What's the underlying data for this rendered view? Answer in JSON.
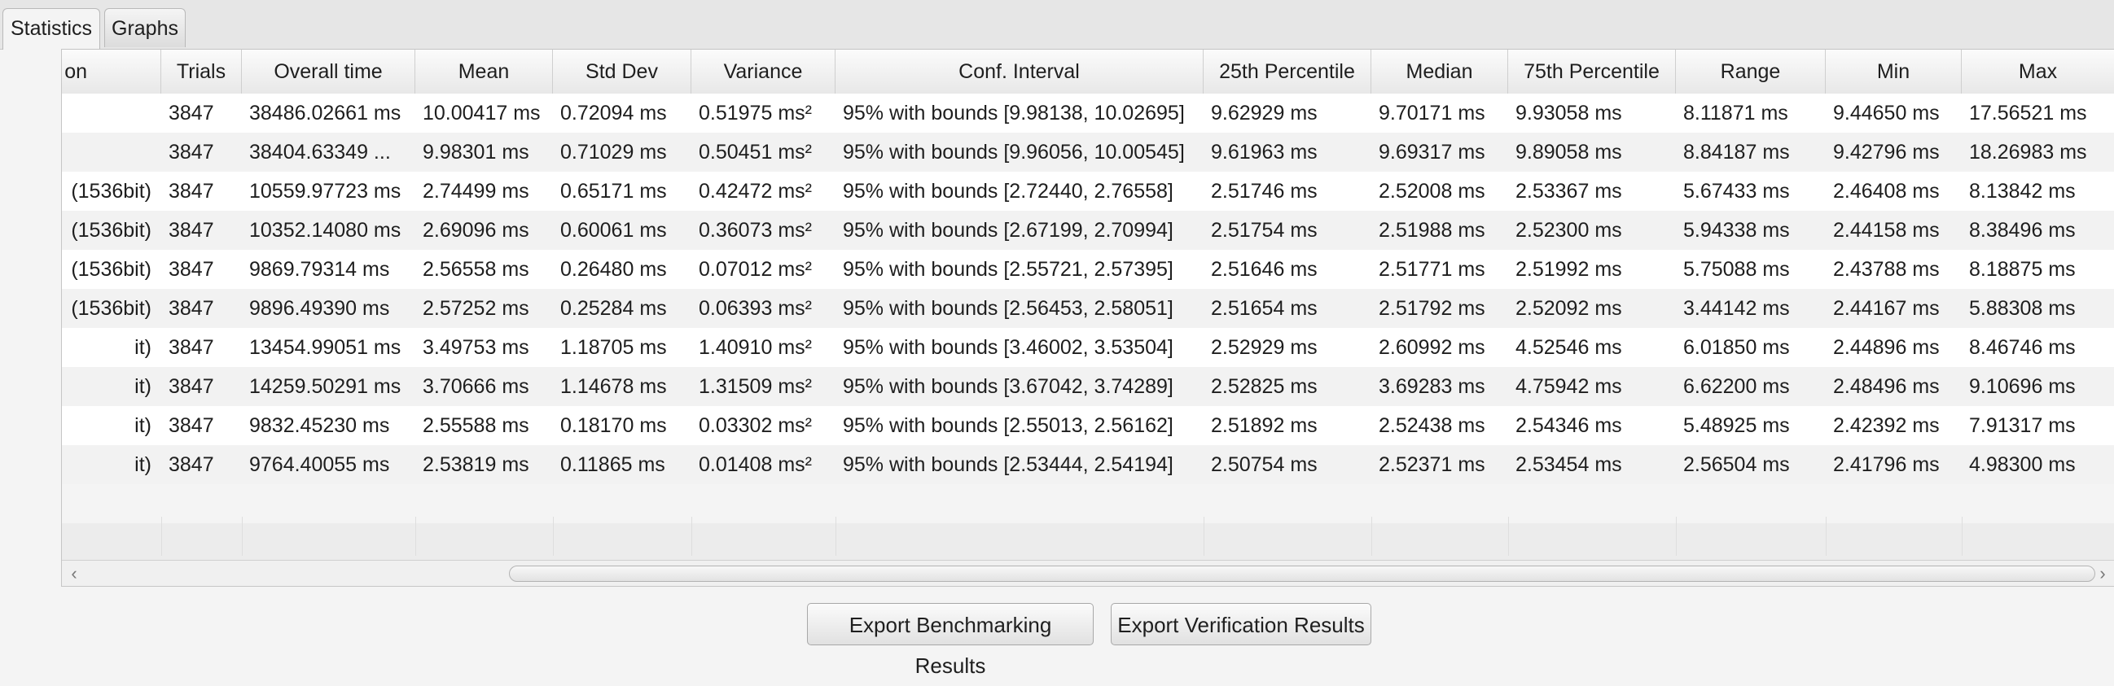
{
  "tabs": [
    {
      "label": "Statistics",
      "selected": true
    },
    {
      "label": "Graphs",
      "selected": false
    }
  ],
  "table": {
    "columns": [
      "on",
      "Trials",
      "Overall time",
      "Mean",
      "Std Dev",
      "Variance",
      "Conf. Interval",
      "25th Percentile",
      "Median",
      "75th Percentile",
      "Range",
      "Min",
      "Max"
    ],
    "rows": [
      [
        "",
        "3847",
        "38486.02661 ms",
        "10.00417 ms",
        "0.72094 ms",
        "0.51975 ms²",
        "95% with bounds [9.98138, 10.02695]",
        "9.62929 ms",
        "9.70171 ms",
        "9.93058 ms",
        "8.11871 ms",
        "9.44650 ms",
        "17.56521 ms"
      ],
      [
        "",
        "3847",
        "38404.63349 ...",
        "9.98301 ms",
        "0.71029 ms",
        "0.50451 ms²",
        "95% with bounds [9.96056, 10.00545]",
        "9.61963 ms",
        "9.69317 ms",
        "9.89058 ms",
        "8.84187 ms",
        "9.42796 ms",
        "18.26983 ms"
      ],
      [
        "(1536bit)",
        "3847",
        "10559.97723 ms",
        "2.74499 ms",
        "0.65171 ms",
        "0.42472 ms²",
        "95% with bounds [2.72440, 2.76558]",
        "2.51746 ms",
        "2.52008 ms",
        "2.53367 ms",
        "5.67433 ms",
        "2.46408 ms",
        "8.13842 ms"
      ],
      [
        "(1536bit)",
        "3847",
        "10352.14080 ms",
        "2.69096 ms",
        "0.60061 ms",
        "0.36073 ms²",
        "95% with bounds [2.67199, 2.70994]",
        "2.51754 ms",
        "2.51988 ms",
        "2.52300 ms",
        "5.94338 ms",
        "2.44158 ms",
        "8.38496 ms"
      ],
      [
        "(1536bit)",
        "3847",
        "9869.79314 ms",
        "2.56558 ms",
        "0.26480 ms",
        "0.07012 ms²",
        "95% with bounds [2.55721, 2.57395]",
        "2.51646 ms",
        "2.51771 ms",
        "2.51992 ms",
        "5.75088 ms",
        "2.43788 ms",
        "8.18875 ms"
      ],
      [
        "(1536bit)",
        "3847",
        "9896.49390 ms",
        "2.57252 ms",
        "0.25284 ms",
        "0.06393 ms²",
        "95% with bounds [2.56453, 2.58051]",
        "2.51654 ms",
        "2.51792 ms",
        "2.52092 ms",
        "3.44142 ms",
        "2.44167 ms",
        "5.88308 ms"
      ],
      [
        "it)",
        "3847",
        "13454.99051 ms",
        "3.49753 ms",
        "1.18705 ms",
        "1.40910 ms²",
        "95% with bounds [3.46002, 3.53504]",
        "2.52929 ms",
        "2.60992 ms",
        "4.52546 ms",
        "6.01850 ms",
        "2.44896 ms",
        "8.46746 ms"
      ],
      [
        "it)",
        "3847",
        "14259.50291 ms",
        "3.70666 ms",
        "1.14678 ms",
        "1.31509 ms²",
        "95% with bounds [3.67042, 3.74289]",
        "2.52825 ms",
        "3.69283 ms",
        "4.75942 ms",
        "6.62200 ms",
        "2.48496 ms",
        "9.10696 ms"
      ],
      [
        "it)",
        "3847",
        "9832.45230 ms",
        "2.55588 ms",
        "0.18170 ms",
        "0.03302 ms²",
        "95% with bounds [2.55013, 2.56162]",
        "2.51892 ms",
        "2.52438 ms",
        "2.54346 ms",
        "5.48925 ms",
        "2.42392 ms",
        "7.91317 ms"
      ],
      [
        "it)",
        "3847",
        "9764.40055 ms",
        "2.53819 ms",
        "0.11865 ms",
        "0.01408 ms²",
        "95% with bounds [2.53444, 2.54194]",
        "2.50754 ms",
        "2.52371 ms",
        "2.53454 ms",
        "2.56504 ms",
        "2.41796 ms",
        "4.98300 ms"
      ]
    ]
  },
  "scrollbar": {
    "left_icon": "chevron-left-icon",
    "right_icon": "chevron-right-icon",
    "left_glyph": "‹",
    "right_glyph": "›"
  },
  "buttons": {
    "export_benchmarking": "Export Benchmarking Results",
    "export_verification": "Export Verification Results"
  }
}
